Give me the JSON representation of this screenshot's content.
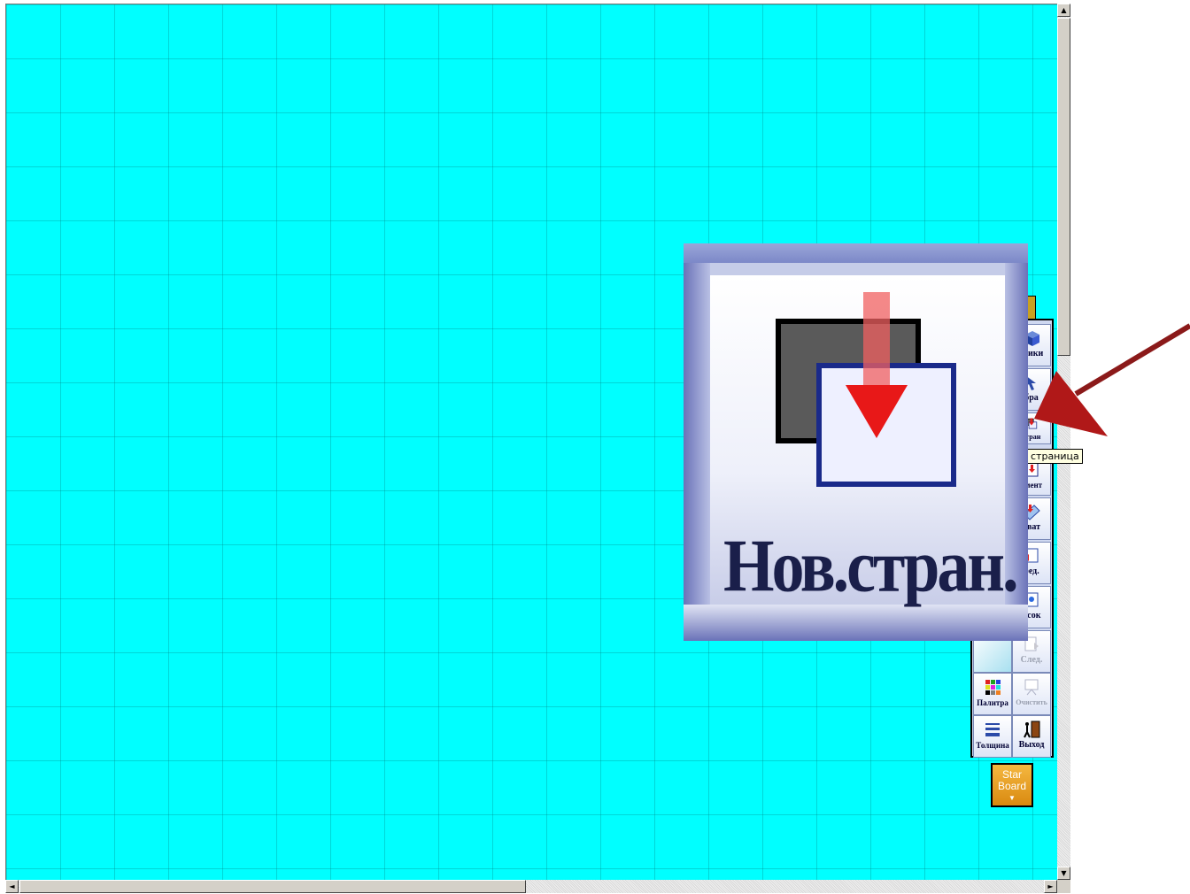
{
  "toolbar": {
    "items": [
      {
        "label": "стики",
        "icon": "cube-icon",
        "enabled": true
      },
      {
        "label": "бра",
        "icon": "cursor-arrow-icon",
        "enabled": true
      },
      {
        "label": "стран",
        "icon": "new-page-icon",
        "enabled": true
      },
      {
        "label": "умент",
        "icon": "document-icon",
        "enabled": true
      },
      {
        "label": "хват",
        "icon": "capture-icon",
        "enabled": true
      },
      {
        "label": "ред.",
        "icon": "previous-page-icon",
        "enabled": true
      },
      {
        "label": "исок",
        "icon": "list-icon",
        "enabled": true
      },
      {
        "label": "След.",
        "icon": "next-page-icon",
        "enabled": false
      },
      {
        "label": "Палитра",
        "icon": "palette-icon",
        "enabled": true
      },
      {
        "label": "Очистить",
        "icon": "clear-board-icon",
        "enabled": false
      },
      {
        "label": "Толщина",
        "icon": "line-width-icon",
        "enabled": true
      },
      {
        "label": "Выход",
        "icon": "exit-door-icon",
        "enabled": true
      }
    ]
  },
  "tooltip": "страница",
  "starboard_button": {
    "line1": "Star",
    "line2": "Board",
    "arrow": "▼"
  },
  "zoom_inset": {
    "label": "Нов.стран.",
    "icon": "new-page-icon"
  },
  "scrollbars": {
    "up": "▲",
    "down": "▼",
    "left": "◄",
    "right": "►"
  },
  "colors": {
    "canvas": "#00ffff",
    "arrow": "#8b1a1a",
    "toolbar": "#cfd8f0"
  }
}
